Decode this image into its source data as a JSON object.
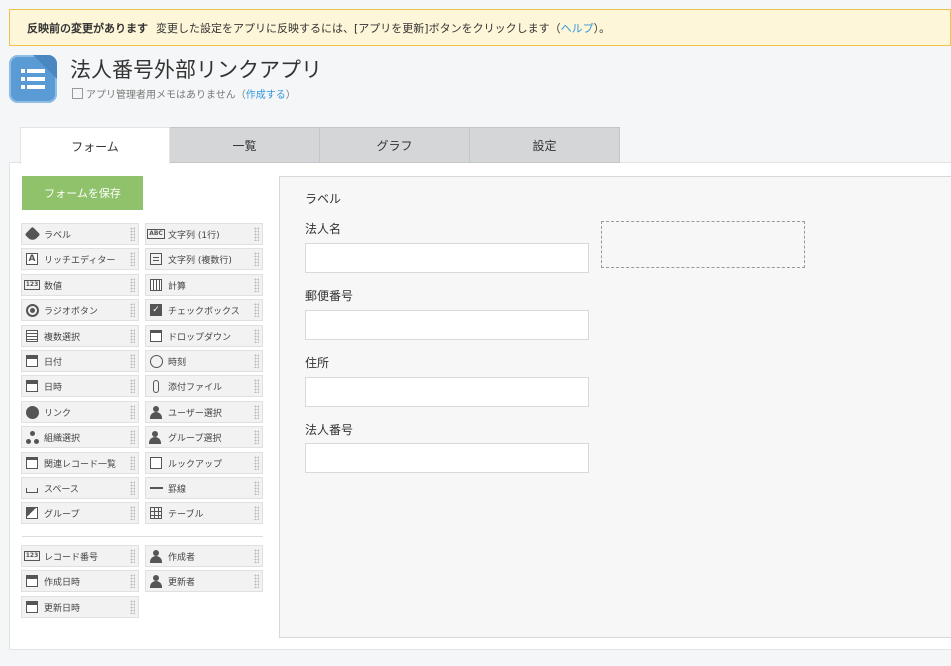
{
  "notice": {
    "title": "反映前の変更があります",
    "message": "変更した設定をアプリに反映するには、[アプリを更新]ボタンをクリックします（",
    "help_link": "ヘルプ",
    "suffix": "）。"
  },
  "app": {
    "icon": "list-icon",
    "icon_color": "#5b9bd5",
    "title": "法人番号外部リンクアプリ",
    "memo_text": "アプリ管理者用メモはありません（",
    "memo_link": "作成する",
    "memo_suffix": "）"
  },
  "tabs": [
    {
      "label": "フォーム",
      "active": true
    },
    {
      "label": "一覧",
      "active": false
    },
    {
      "label": "グラフ",
      "active": false
    },
    {
      "label": "設定",
      "active": false
    }
  ],
  "save_button": {
    "label": "フォームを保存",
    "color": "#8fc26b"
  },
  "palette": {
    "fields": [
      {
        "label": "ラベル",
        "icon": "tag-icon"
      },
      {
        "label": "文字列 (1行)",
        "icon": "abc-text-icon"
      },
      {
        "label": "リッチエディター",
        "icon": "rich-editor-icon"
      },
      {
        "label": "文字列 (複数行)",
        "icon": "multiline-text-icon"
      },
      {
        "label": "数値",
        "icon": "number-icon"
      },
      {
        "label": "計算",
        "icon": "calculator-icon"
      },
      {
        "label": "ラジオボタン",
        "icon": "radio-icon"
      },
      {
        "label": "チェックボックス",
        "icon": "checkbox-icon"
      },
      {
        "label": "複数選択",
        "icon": "multi-select-icon"
      },
      {
        "label": "ドロップダウン",
        "icon": "dropdown-icon"
      },
      {
        "label": "日付",
        "icon": "calendar-icon"
      },
      {
        "label": "時刻",
        "icon": "clock-icon"
      },
      {
        "label": "日時",
        "icon": "datetime-icon"
      },
      {
        "label": "添付ファイル",
        "icon": "paperclip-icon"
      },
      {
        "label": "リンク",
        "icon": "globe-icon"
      },
      {
        "label": "ユーザー選択",
        "icon": "user-icon"
      },
      {
        "label": "組織選択",
        "icon": "org-icon"
      },
      {
        "label": "グループ選択",
        "icon": "group-icon"
      },
      {
        "label": "関連レコード一覧",
        "icon": "related-records-icon"
      },
      {
        "label": "ルックアップ",
        "icon": "lookup-icon"
      },
      {
        "label": "スペース",
        "icon": "space-icon"
      },
      {
        "label": "罫線",
        "icon": "line-icon"
      },
      {
        "label": "グループ",
        "icon": "group-folder-icon"
      },
      {
        "label": "テーブル",
        "icon": "table-icon"
      }
    ],
    "system_fields": [
      {
        "label": "レコード番号",
        "icon": "record-number-icon"
      },
      {
        "label": "作成者",
        "icon": "creator-icon"
      },
      {
        "label": "作成日時",
        "icon": "created-datetime-icon"
      },
      {
        "label": "更新者",
        "icon": "updater-icon"
      },
      {
        "label": "更新日時",
        "icon": "updated-datetime-icon"
      }
    ]
  },
  "form": {
    "label_element": "ラベル",
    "fields": [
      {
        "label": "法人名",
        "value": ""
      },
      {
        "label": "郵便番号",
        "value": ""
      },
      {
        "label": "住所",
        "value": ""
      },
      {
        "label": "法人番号",
        "value": ""
      }
    ]
  }
}
